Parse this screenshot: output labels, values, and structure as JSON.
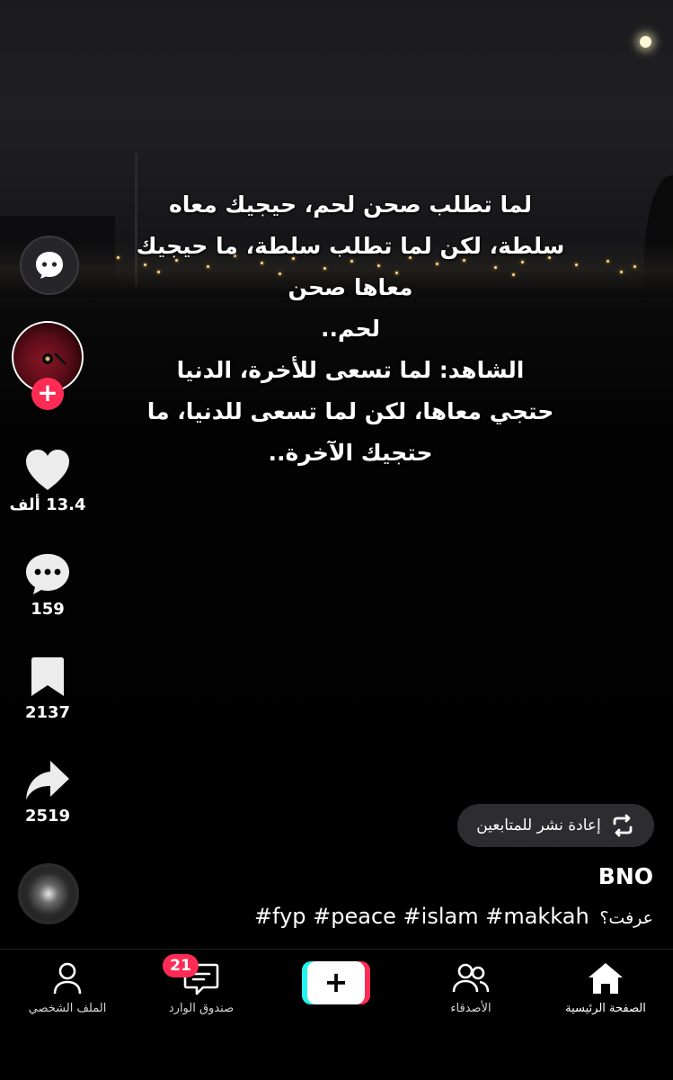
{
  "video": {
    "caption_lines": [
      "لما تطلب صحن لحم، حيجيك معاه",
      "سلطة، لكن لما تطلب سلطة، ما حيجيك",
      "معاها صحن",
      "لحم..",
      "الشاهد: لما تسعى للأخرة، الدنيا",
      "حتجي معاها، لكن لما تسعى للدنيا، ما",
      "حتجيك الآخرة.."
    ]
  },
  "sidebar": {
    "chat_icon": "chat-bubble-face-icon",
    "likes": "13.4 ألف",
    "comments": "159",
    "bookmarks": "2137",
    "shares": "2519"
  },
  "repost": {
    "label": "إعادة نشر للمتابعين",
    "icon": "repost-icon"
  },
  "post": {
    "author": "BNO",
    "question": "عرفت؟",
    "hashtags": "#fyp #peace #islam #makkah"
  },
  "nav": {
    "home": "الصفحة الرئيسية",
    "friends": "الأصدقاء",
    "create": "+",
    "inbox": "صندوق الوارد",
    "inbox_badge": "21",
    "profile": "الملف الشخصي"
  },
  "colors": {
    "accent": "#fe2c55",
    "cyan": "#25f4ee",
    "background": "#000000"
  }
}
